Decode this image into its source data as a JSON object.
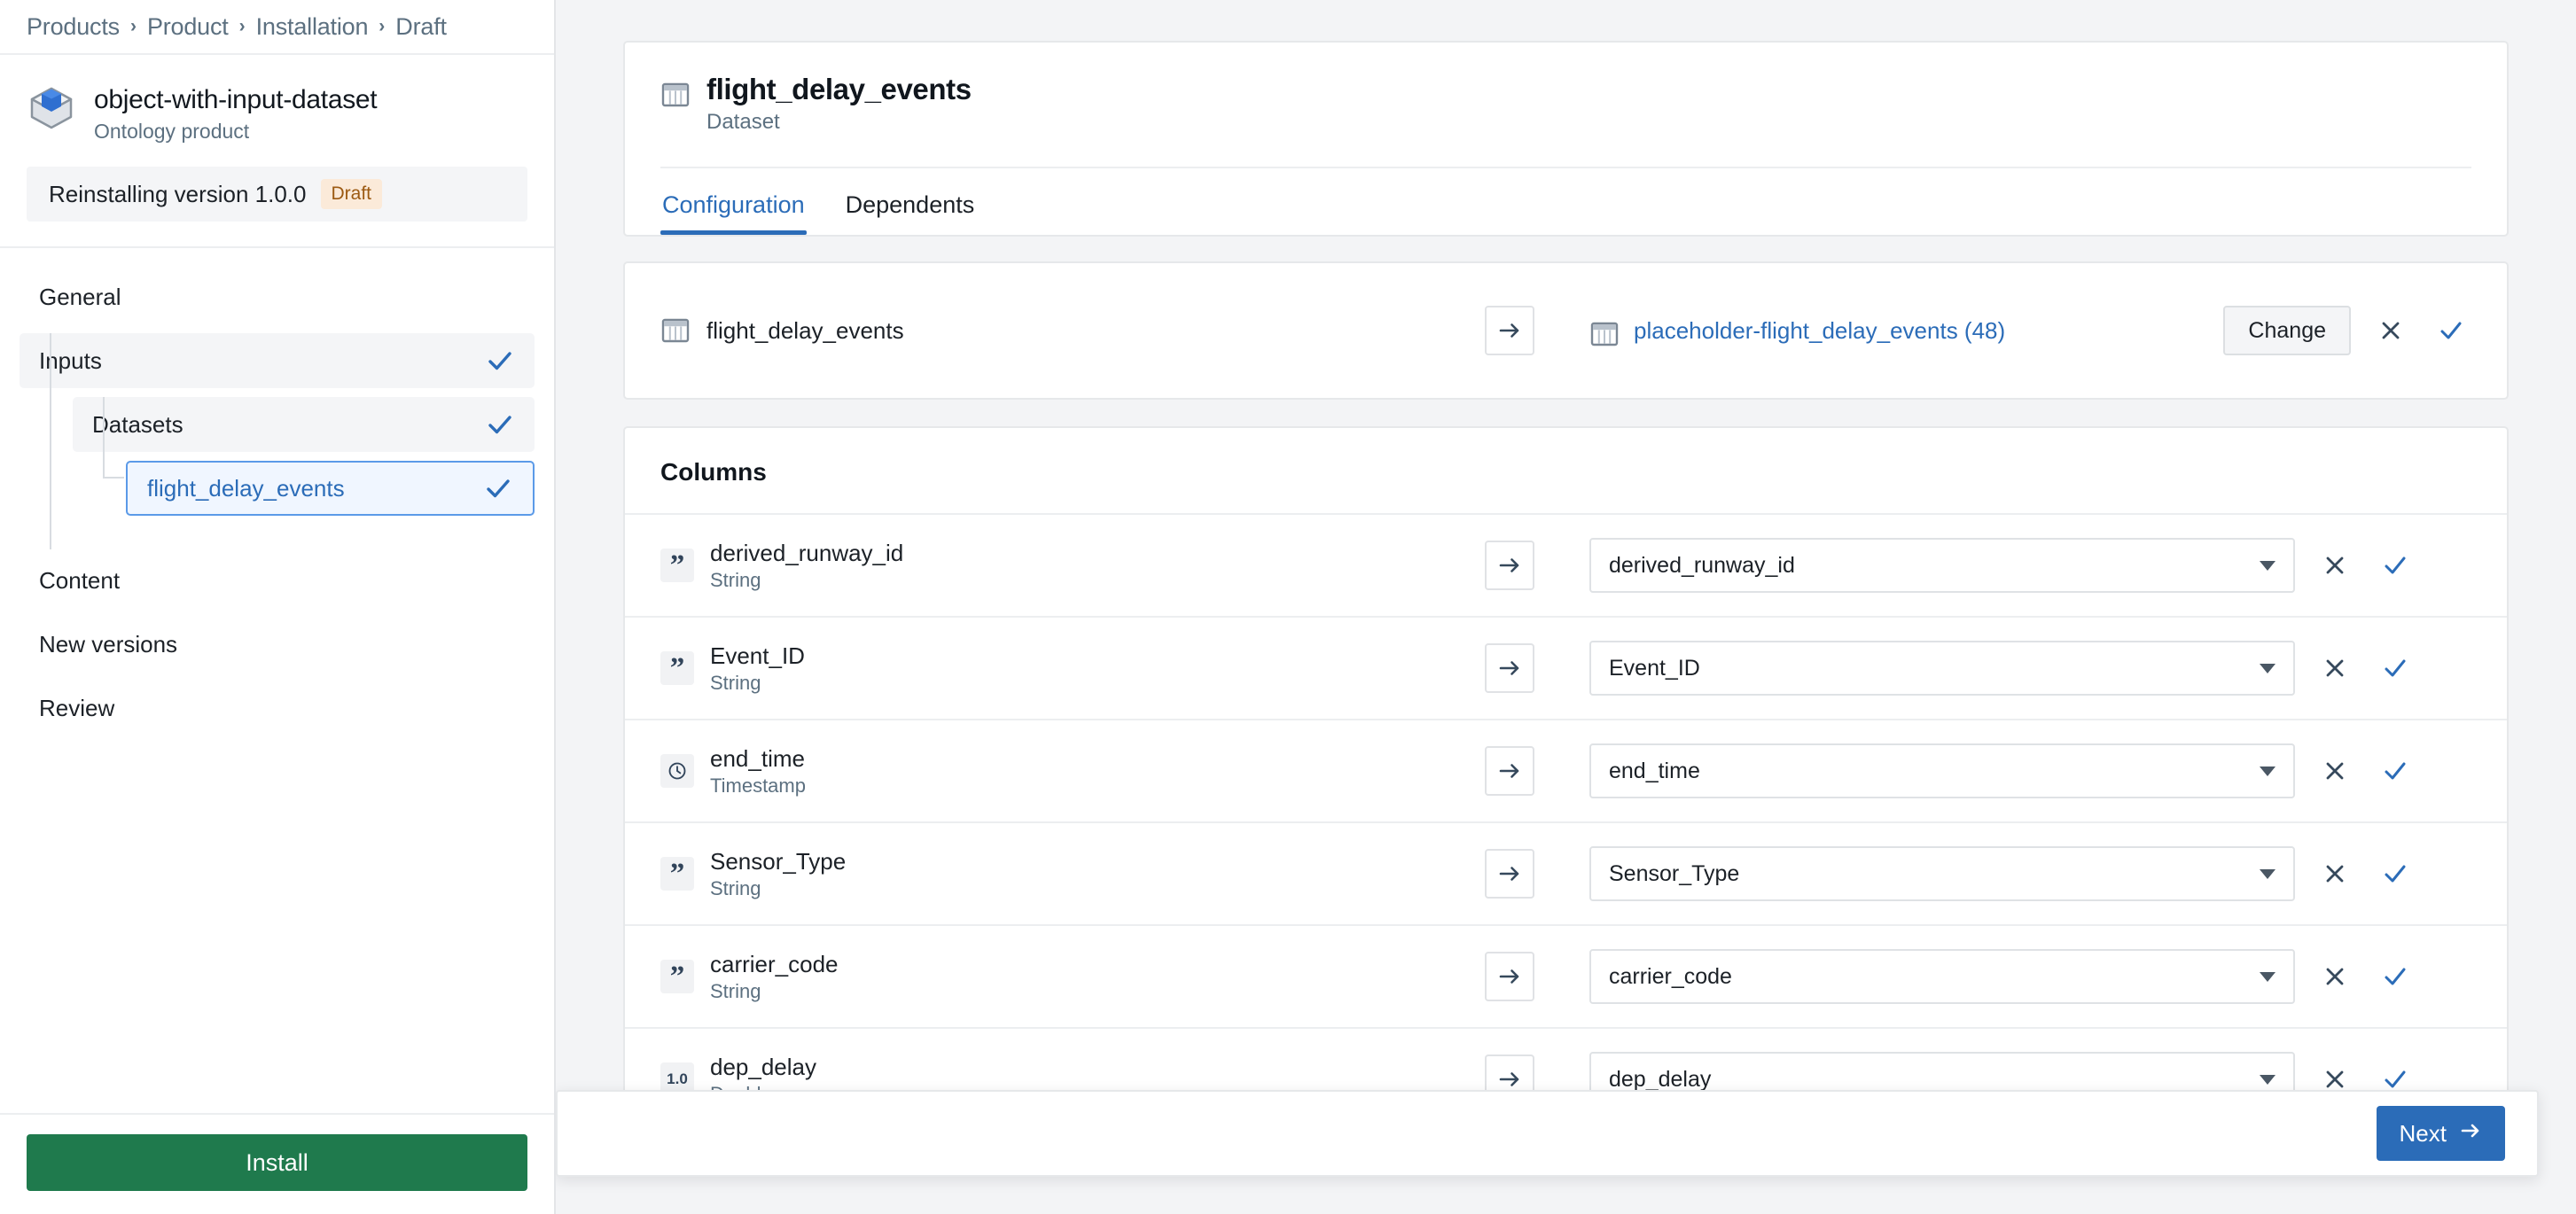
{
  "breadcrumb": {
    "items": [
      "Products",
      "Product",
      "Installation",
      "Draft"
    ],
    "separator": "›"
  },
  "product": {
    "icon": "cube-icon",
    "title": "object-with-input-dataset",
    "subtitle": "Ontology product"
  },
  "version_banner": {
    "label": "Reinstalling version 1.0.0",
    "badge": "Draft",
    "badge_color": "#9c5a12",
    "badge_bg": "#fbead9"
  },
  "sidebar": {
    "nav": [
      {
        "label": "General",
        "level": 0,
        "state": "plain",
        "checked": false
      },
      {
        "label": "Inputs",
        "level": 0,
        "state": "active-soft",
        "checked": true
      },
      {
        "label": "Datasets",
        "level": 1,
        "state": "active-soft",
        "checked": true
      },
      {
        "label": "flight_delay_events",
        "level": 2,
        "state": "selected",
        "checked": true
      },
      {
        "label": "Content",
        "level": 0,
        "state": "plain",
        "checked": false
      },
      {
        "label": "New versions",
        "level": 0,
        "state": "plain",
        "checked": false
      },
      {
        "label": "Review",
        "level": 0,
        "state": "plain",
        "checked": false
      }
    ],
    "install_button": "Install",
    "install_color": "#1f7a4d",
    "check_color": "#2b6cb8"
  },
  "main": {
    "dataset": {
      "icon": "table-icon",
      "title": "flight_delay_events",
      "subtitle": "Dataset"
    },
    "tabs": [
      {
        "label": "Configuration",
        "active": true
      },
      {
        "label": "Dependents",
        "active": false
      }
    ],
    "mapping": {
      "source_icon": "table-icon",
      "source_label": "flight_delay_events",
      "arrow_icon": "arrow-right-icon",
      "target_icon": "table-icon",
      "target_label": "placeholder-flight_delay_events (48)",
      "change_label": "Change",
      "clear_icon": "x-icon",
      "confirm_icon": "check-icon"
    },
    "columns_section": {
      "title": "Columns",
      "rows": [
        {
          "name": "derived_runway_id",
          "type": "String",
          "type_icon": "quote-icon",
          "mapped_value": "derived_runway_id"
        },
        {
          "name": "Event_ID",
          "type": "String",
          "type_icon": "quote-icon",
          "mapped_value": "Event_ID"
        },
        {
          "name": "end_time",
          "type": "Timestamp",
          "type_icon": "clock-icon",
          "mapped_value": "end_time"
        },
        {
          "name": "Sensor_Type",
          "type": "String",
          "type_icon": "quote-icon",
          "mapped_value": "Sensor_Type"
        },
        {
          "name": "carrier_code",
          "type": "String",
          "type_icon": "quote-icon",
          "mapped_value": "carrier_code"
        },
        {
          "name": "dep_delay",
          "type": "Double",
          "type_icon": "decimal-icon",
          "type_glyph": "1.0",
          "mapped_value": "dep_delay"
        }
      ]
    },
    "footer": {
      "next_label": "Next",
      "next_icon": "arrow-right-icon",
      "next_color": "#2b6cb8"
    }
  }
}
